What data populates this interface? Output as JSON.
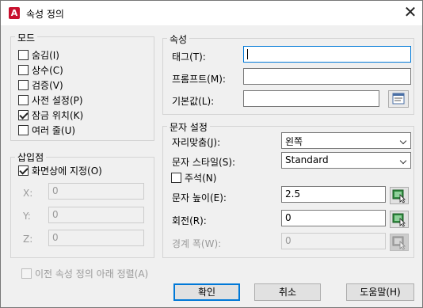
{
  "window": {
    "title": "속성 정의",
    "app_icon_letter": "A"
  },
  "mode": {
    "title": "모드",
    "items": [
      {
        "label": "숨김(I)",
        "checked": false
      },
      {
        "label": "상수(C)",
        "checked": false
      },
      {
        "label": "검증(V)",
        "checked": false
      },
      {
        "label": "사전 설정(P)",
        "checked": false
      },
      {
        "label": "잠금 위치(K)",
        "checked": true
      },
      {
        "label": "여러 줄(U)",
        "checked": false
      }
    ]
  },
  "insertion": {
    "title": "삽입점",
    "specify_label": "화면상에 지정(O)",
    "specify_checked": true,
    "x_label": "X:",
    "x_value": "0",
    "y_label": "Y:",
    "y_value": "0",
    "z_label": "Z:",
    "z_value": "0"
  },
  "attribute": {
    "title": "속성",
    "tag_label": "태그(T):",
    "tag_value": "",
    "prompt_label": "프롬프트(M):",
    "prompt_value": "",
    "default_label": "기본값(L):",
    "default_value": ""
  },
  "text": {
    "title": "문자 설정",
    "justify_label": "자리맞춤(J):",
    "justify_value": "왼쪽",
    "style_label": "문자 스타일(S):",
    "style_value": "Standard",
    "annotative_label": "주석(N)",
    "annotative_checked": false,
    "height_label": "문자 높이(E):",
    "height_value": "2.5",
    "rotation_label": "회전(R):",
    "rotation_value": "0",
    "boundary_label": "경계 폭(W):",
    "boundary_value": "0"
  },
  "align_below": {
    "label": "이전 속성 정의 아래 정렬(A)",
    "checked": false
  },
  "buttons": {
    "ok": "확인",
    "cancel": "취소",
    "help": "도움말(H)"
  }
}
